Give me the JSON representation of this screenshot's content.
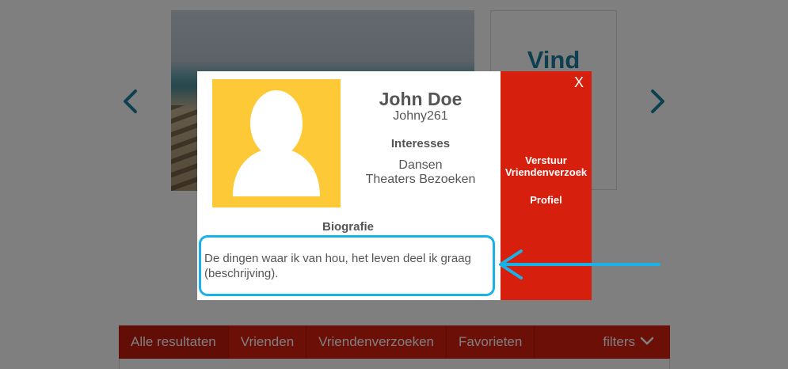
{
  "background": {
    "card_title": "Vind",
    "nav_prev_icon": "chevron-left-icon",
    "nav_next_icon": "chevron-right-icon"
  },
  "tabs": [
    {
      "label": "Alle resultaten",
      "active": true
    },
    {
      "label": "Vrienden",
      "active": false
    },
    {
      "label": "Vriendenverzoeken",
      "active": false
    },
    {
      "label": "Favorieten",
      "active": false
    },
    {
      "label": "filters",
      "active": false
    }
  ],
  "modal": {
    "name": "John Doe",
    "username": "Johny261",
    "interests_heading": "Interesses",
    "interests": [
      "Dansen",
      "Theaters Bezoeken"
    ],
    "bio_heading": "Biografie",
    "bio_text": "De dingen waar ik van hou, het leven deel ik graag (beschrijving).",
    "close_label": "X",
    "friend_request_line1": "Verstuur",
    "friend_request_line2": "Vriendenverzoek",
    "profile_label": "Profiel"
  },
  "colors": {
    "accent_red": "#d71f0e",
    "avatar_yellow": "#fec937",
    "highlight_blue": "#17b2e8",
    "teal_link": "#1a7fa3"
  }
}
